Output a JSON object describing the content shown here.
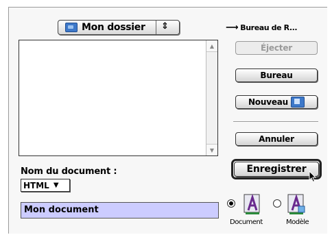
{
  "location_popup": {
    "label": "Mon dossier",
    "arrows": "⇕"
  },
  "desktop_link": "Bureau de R...",
  "buttons": {
    "eject": "Éjecter",
    "desktop": "Bureau",
    "new_folder": "Nouveau",
    "cancel": "Annuler",
    "save": "Enregistrer"
  },
  "document_name_label": "Nom du document :",
  "format_popup": {
    "selected": "HTML"
  },
  "document_name_value": "Mon document",
  "save_as": {
    "options": [
      "Document",
      "Modèle"
    ],
    "selected": "Document"
  },
  "colors": {
    "name_field_highlight": "#ccccff",
    "folder_blue": "#3d78c9",
    "format_icon_purple": "#6a2a8e"
  }
}
